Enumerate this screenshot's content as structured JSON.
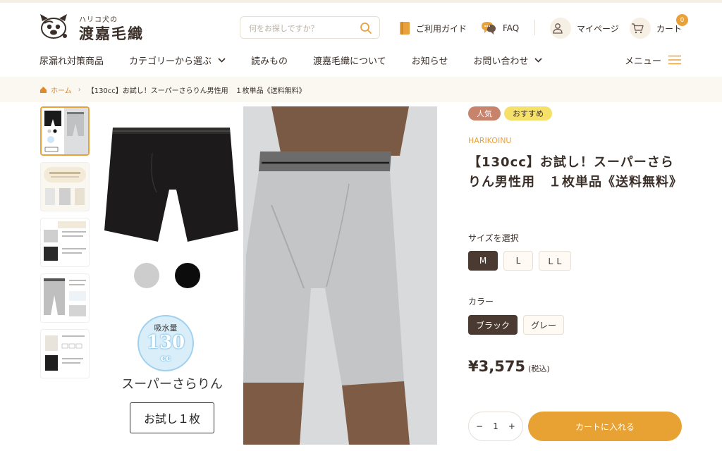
{
  "header": {
    "logo_small": "ハリコ犬の",
    "logo_big": "渡嘉毛織",
    "search_placeholder": "何をお探しですか？",
    "guide": "ご利用ガイド",
    "faq": "FAQ",
    "mypage": "マイページ",
    "cart": "カート",
    "cart_count": "0"
  },
  "nav": {
    "items": [
      "尿漏れ対策商品",
      "カテゴリーから選ぶ",
      "読みもの",
      "渡嘉毛織について",
      "お知らせ",
      "お問い合わせ"
    ],
    "menu": "メニュー"
  },
  "breadcrumb": {
    "home": "ホーム",
    "current": "【130cc】お試し！スーパーさらりん男性用　１枚単品《送料無料》"
  },
  "gallery": {
    "absorb_label": "吸水量",
    "absorb_value": "130",
    "absorb_unit": "cc",
    "product_name": "スーパーさらりん",
    "trial": "お試し１枚"
  },
  "product": {
    "badge_popular": "人気",
    "badge_recommend": "おすすめ",
    "brand": "HARIKOINU",
    "title": "【130cc】お試し！スーパーさらりん男性用　１枚単品《送料無料》",
    "size_label": "サイズを選択",
    "sizes": [
      "M",
      "L",
      "ＬＬ"
    ],
    "color_label": "カラー",
    "colors": [
      "ブラック",
      "グレー"
    ],
    "price": "¥3,575",
    "tax": "(税込)",
    "qty_minus": "−",
    "qty_value": "1",
    "qty_plus": "+",
    "add_to_cart": "カートに入れる"
  },
  "colors": {
    "accent": "#e9a23b",
    "dark": "#4a3a32",
    "badge_popular": "#c7836c",
    "badge_recommend": "#f5e06a"
  }
}
